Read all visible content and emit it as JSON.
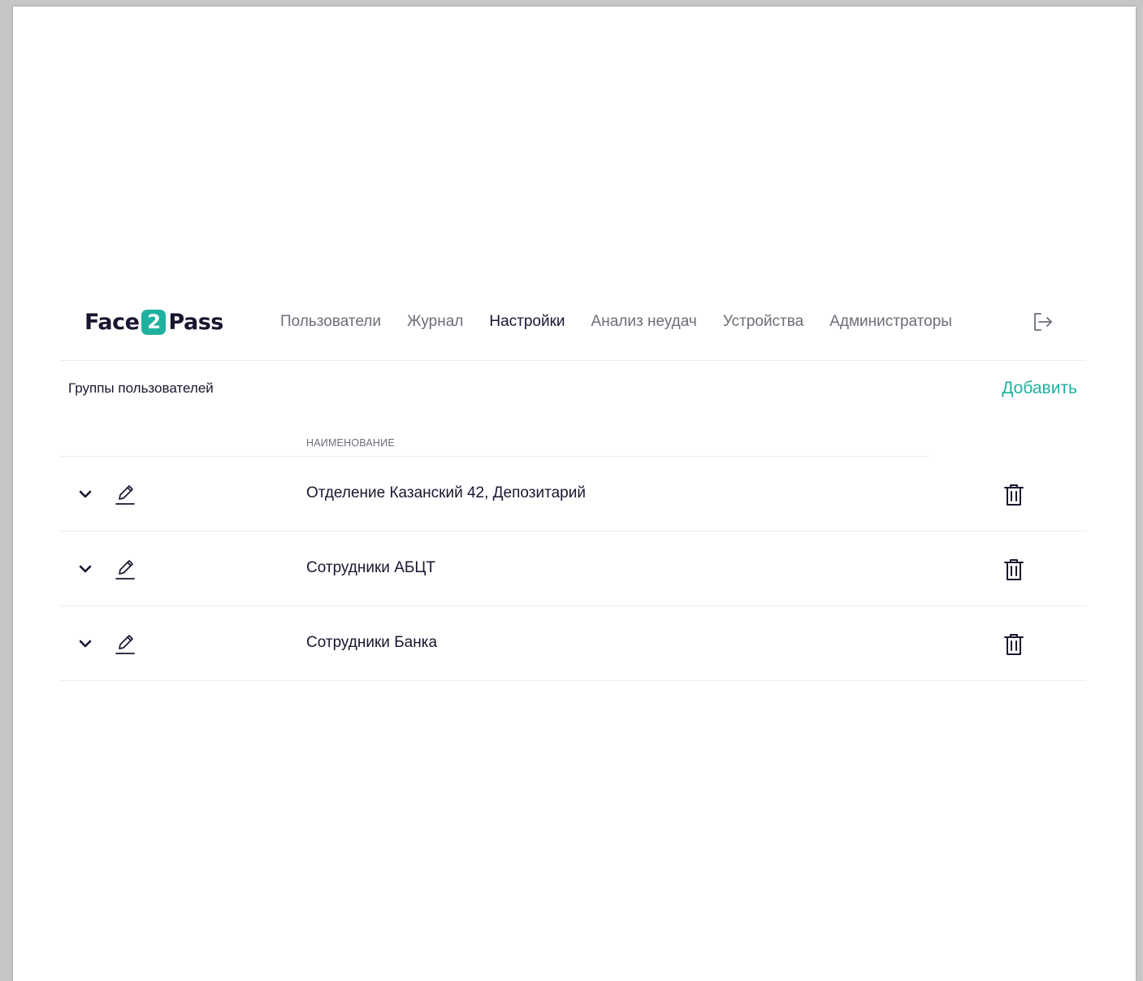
{
  "brand": {
    "part1": "Face",
    "part2": "2",
    "part3": "Pass",
    "accent": "#1fb1a0"
  },
  "nav": {
    "items": [
      {
        "label": "Пользователи",
        "active": false
      },
      {
        "label": "Журнал",
        "active": false
      },
      {
        "label": "Настройки",
        "active": true
      },
      {
        "label": "Анализ неудач",
        "active": false
      },
      {
        "label": "Устройства",
        "active": false
      },
      {
        "label": "Администраторы",
        "active": false
      }
    ],
    "logout_icon": "logout-icon"
  },
  "section": {
    "title": "Группы пользователей",
    "add_label": "Добавить"
  },
  "table": {
    "column_header": "НАИМЕНОВАНИЕ",
    "rows": [
      {
        "name": "Отделение Казанский 42, Депозитарий"
      },
      {
        "name": "Сотрудники АБЦТ"
      },
      {
        "name": "Сотрудники Банка"
      }
    ],
    "row_icons": [
      "chevron-down-icon",
      "pencil-icon",
      "trash-icon"
    ]
  }
}
